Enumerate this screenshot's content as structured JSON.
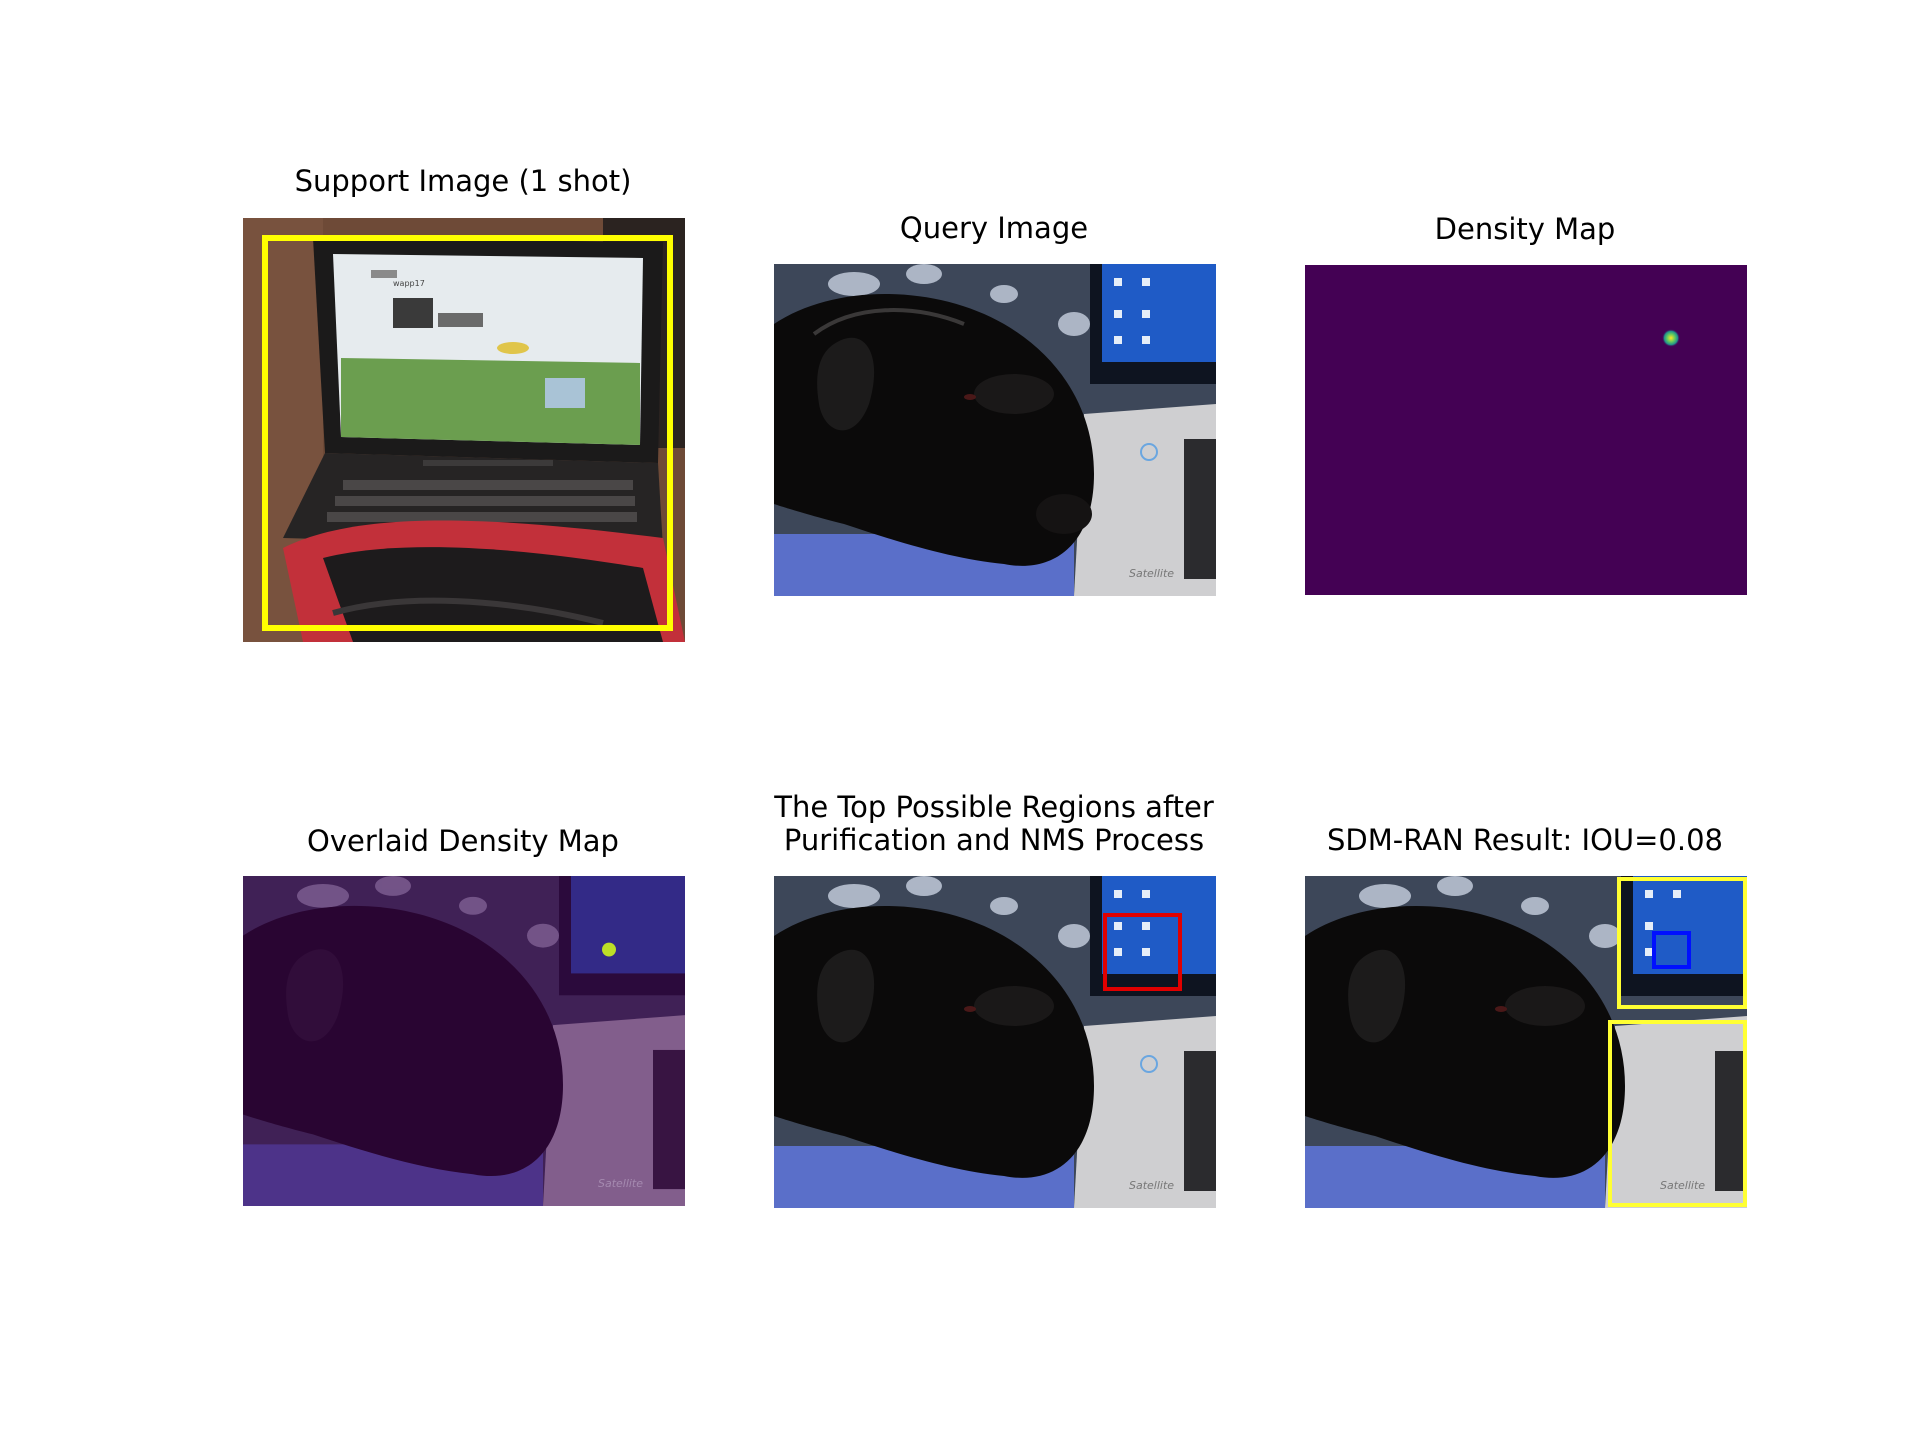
{
  "figure": {
    "panels": [
      {
        "title": "Support Image (1 shot)"
      },
      {
        "title": "Query Image"
      },
      {
        "title": "Density Map"
      },
      {
        "title": "Overlaid Density Map"
      },
      {
        "title_line1": "The Top Possible Regions after",
        "title_line2": "Purification and NMS Process"
      },
      {
        "title": "SDM-RAN Result: IOU=0.08"
      }
    ],
    "support_image": {
      "screen_brand": "wapp17"
    },
    "query_image": {
      "device_label": "Satellite"
    },
    "colors": {
      "support_box": "#ffff00",
      "region_box": "#e00000",
      "prediction_box": "#ffff33",
      "groundtruth_box": "#0010ff",
      "density_background": "#440154",
      "density_peak": "#bddf26"
    }
  }
}
